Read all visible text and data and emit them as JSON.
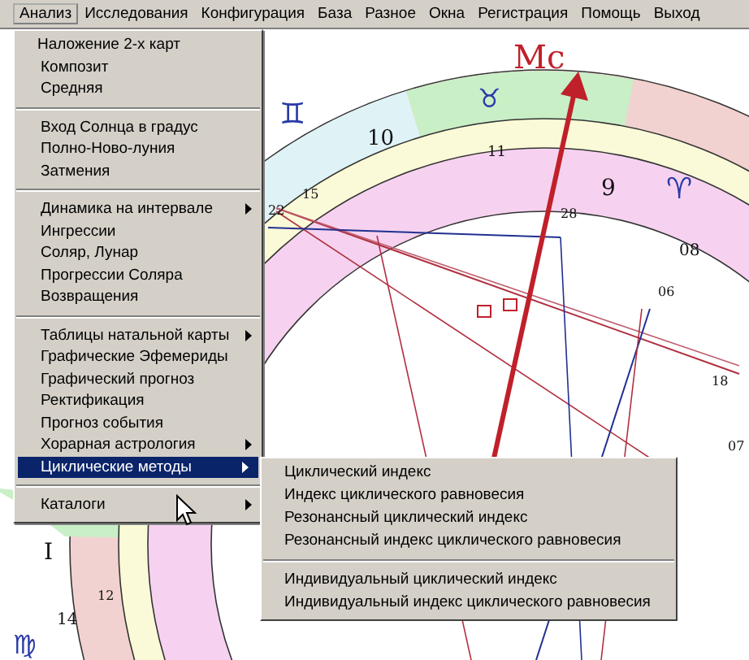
{
  "menubar": [
    {
      "label": "Анализ",
      "selected": true
    },
    {
      "label": "Исследования",
      "selected": false
    },
    {
      "label": "Конфигурация",
      "selected": false
    },
    {
      "label": "База",
      "selected": false
    },
    {
      "label": "Разное",
      "selected": false
    },
    {
      "label": "Окна",
      "selected": false
    },
    {
      "label": "Регистрация",
      "selected": false
    },
    {
      "label": "Помощь",
      "selected": false
    },
    {
      "label": "Выход",
      "selected": false
    }
  ],
  "menu": [
    {
      "kind": "item",
      "label": "Наложение 2-х карт",
      "submenu": false,
      "selected": false
    },
    {
      "kind": "item",
      "label": "Композит",
      "submenu": false,
      "selected": false
    },
    {
      "kind": "item",
      "label": "Средняя",
      "submenu": false,
      "selected": false
    },
    {
      "kind": "separator"
    },
    {
      "kind": "item",
      "label": "Вход Солнца в градус",
      "submenu": false,
      "selected": false
    },
    {
      "kind": "item",
      "label": "Полно-Ново-луния",
      "submenu": false,
      "selected": false
    },
    {
      "kind": "item",
      "label": "Затмения",
      "submenu": false,
      "selected": false
    },
    {
      "kind": "separator"
    },
    {
      "kind": "item",
      "label": "Динамика на интервале",
      "submenu": true,
      "selected": false
    },
    {
      "kind": "item",
      "label": "Ингрессии",
      "submenu": false,
      "selected": false
    },
    {
      "kind": "item",
      "label": "Соляр, Лунар",
      "submenu": false,
      "selected": false
    },
    {
      "kind": "item",
      "label": "Прогрессии Соляра",
      "submenu": false,
      "selected": false
    },
    {
      "kind": "item",
      "label": "Возвращения",
      "submenu": false,
      "selected": false
    },
    {
      "kind": "separator"
    },
    {
      "kind": "item",
      "label": "Таблицы натальной карты",
      "submenu": true,
      "selected": false
    },
    {
      "kind": "item",
      "label": "Графические Эфемериды",
      "submenu": false,
      "selected": false
    },
    {
      "kind": "item",
      "label": "Графический прогноз",
      "submenu": false,
      "selected": false
    },
    {
      "kind": "item",
      "label": "Ректификация",
      "submenu": false,
      "selected": false
    },
    {
      "kind": "item",
      "label": "Прогноз события",
      "submenu": false,
      "selected": false
    },
    {
      "kind": "item",
      "label": "Хорарная астрология",
      "submenu": true,
      "selected": false
    },
    {
      "kind": "item",
      "label": "Циклические методы",
      "submenu": true,
      "selected": true
    },
    {
      "kind": "separator"
    },
    {
      "kind": "item",
      "label": "Каталоги",
      "submenu": true,
      "selected": false
    }
  ],
  "submenu": [
    {
      "kind": "item",
      "label": "Циклический индекс"
    },
    {
      "kind": "item",
      "label": "Индекс циклического равновесия"
    },
    {
      "kind": "item",
      "label": "Резонансный циклический индекс"
    },
    {
      "kind": "item",
      "label": "Резонансный индекс циклического равновесия"
    },
    {
      "kind": "separator"
    },
    {
      "kind": "item",
      "label": "Индивидуальный циклический индекс"
    },
    {
      "kind": "item",
      "label": "Индивидуальный индекс циклического равновесия"
    }
  ],
  "chart_labels": [
    "Mc",
    "♊",
    "♉",
    "♈",
    "10",
    "11",
    "9",
    "08",
    "28",
    "06",
    "18",
    "07",
    "15",
    "22",
    "I",
    "12",
    "14",
    "♍"
  ]
}
